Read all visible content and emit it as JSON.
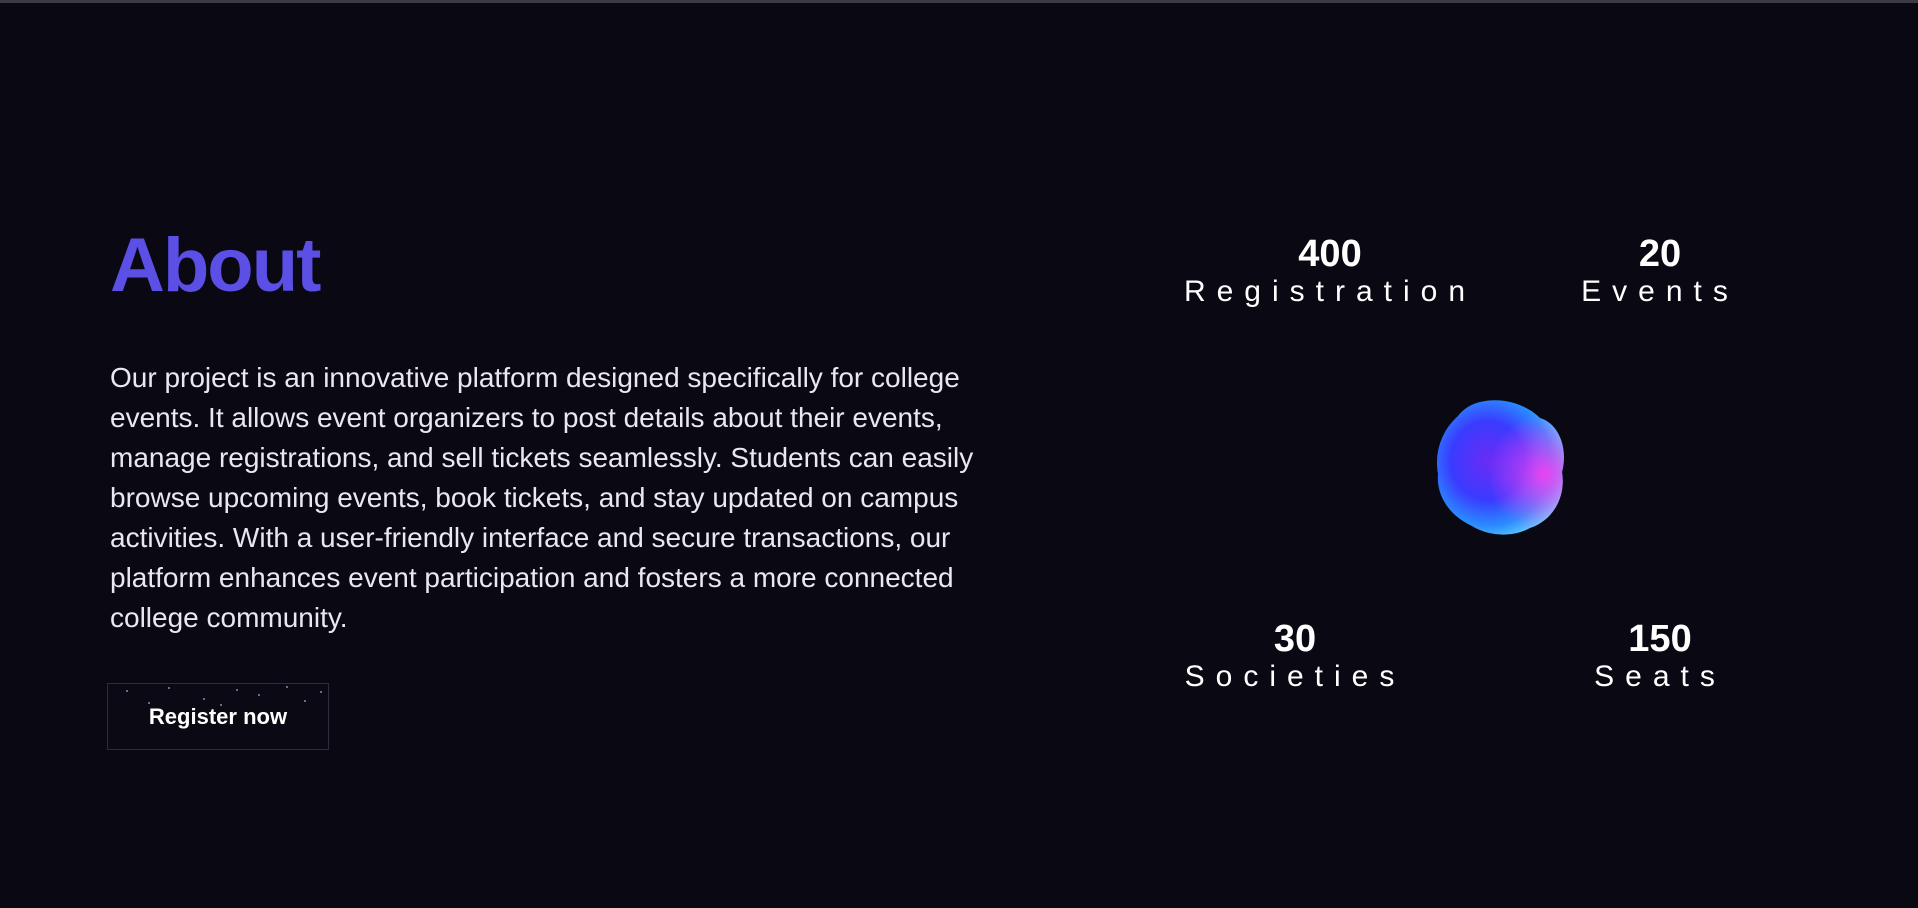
{
  "about": {
    "title": "About",
    "description": "Our project is an innovative platform designed specifically for college events. It allows event organizers to post details about their events, manage registrations, and sell tickets seamlessly. Students can easily browse upcoming events, book tickets, and stay updated on campus activities. With a user-friendly interface and secure transactions, our platform enhances event participation and fosters a more connected college community.",
    "register_label": "Register now"
  },
  "stats": [
    {
      "value": "400",
      "label": "Registration"
    },
    {
      "value": "20",
      "label": "Events"
    },
    {
      "value": "30",
      "label": "Societies"
    },
    {
      "value": "150",
      "label": "Seats"
    }
  ],
  "colors": {
    "background": "#0a0913",
    "accent": "#5b4fe6",
    "text": "#ffffff"
  },
  "decor": {
    "blob_icon": "gradient-blob-icon"
  }
}
